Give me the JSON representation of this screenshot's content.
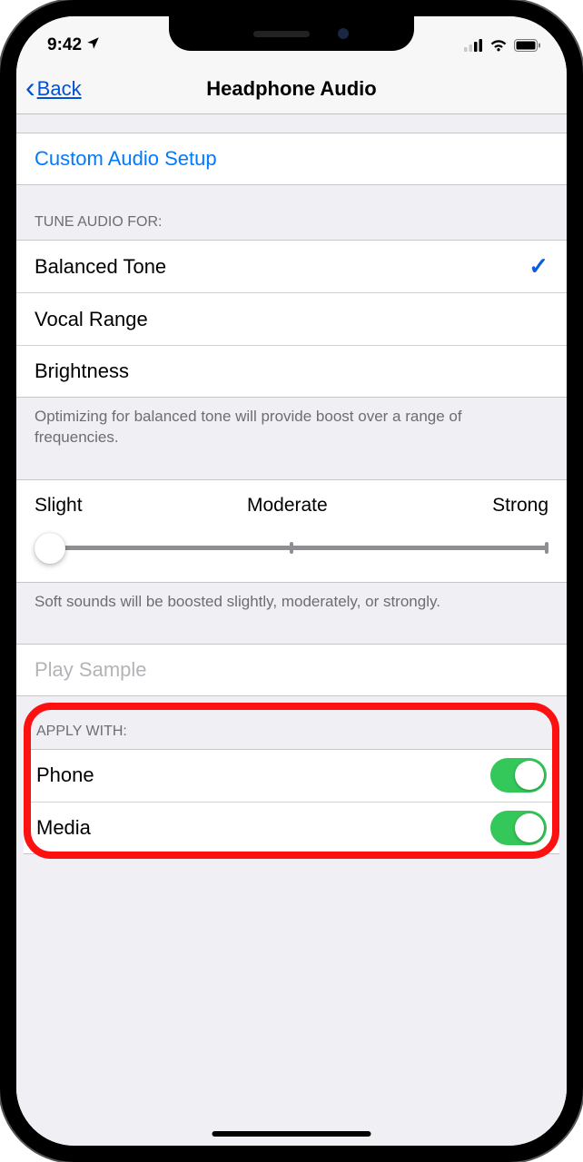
{
  "status": {
    "time": "9:42",
    "location_icon": "➤"
  },
  "nav": {
    "back": "Back",
    "title": "Headphone Audio"
  },
  "custom_setup": "Custom Audio Setup",
  "tune": {
    "header": "TUNE AUDIO FOR:",
    "options": [
      "Balanced Tone",
      "Vocal Range",
      "Brightness"
    ],
    "selected_index": 0,
    "footer": "Optimizing for balanced tone will provide boost over a range of frequencies."
  },
  "slider": {
    "labels": [
      "Slight",
      "Moderate",
      "Strong"
    ],
    "footer": "Soft sounds will be boosted slightly, moderately, or strongly."
  },
  "play_sample": "Play Sample",
  "apply": {
    "header": "APPLY WITH:",
    "items": [
      {
        "label": "Phone",
        "on": true
      },
      {
        "label": "Media",
        "on": true
      }
    ]
  }
}
